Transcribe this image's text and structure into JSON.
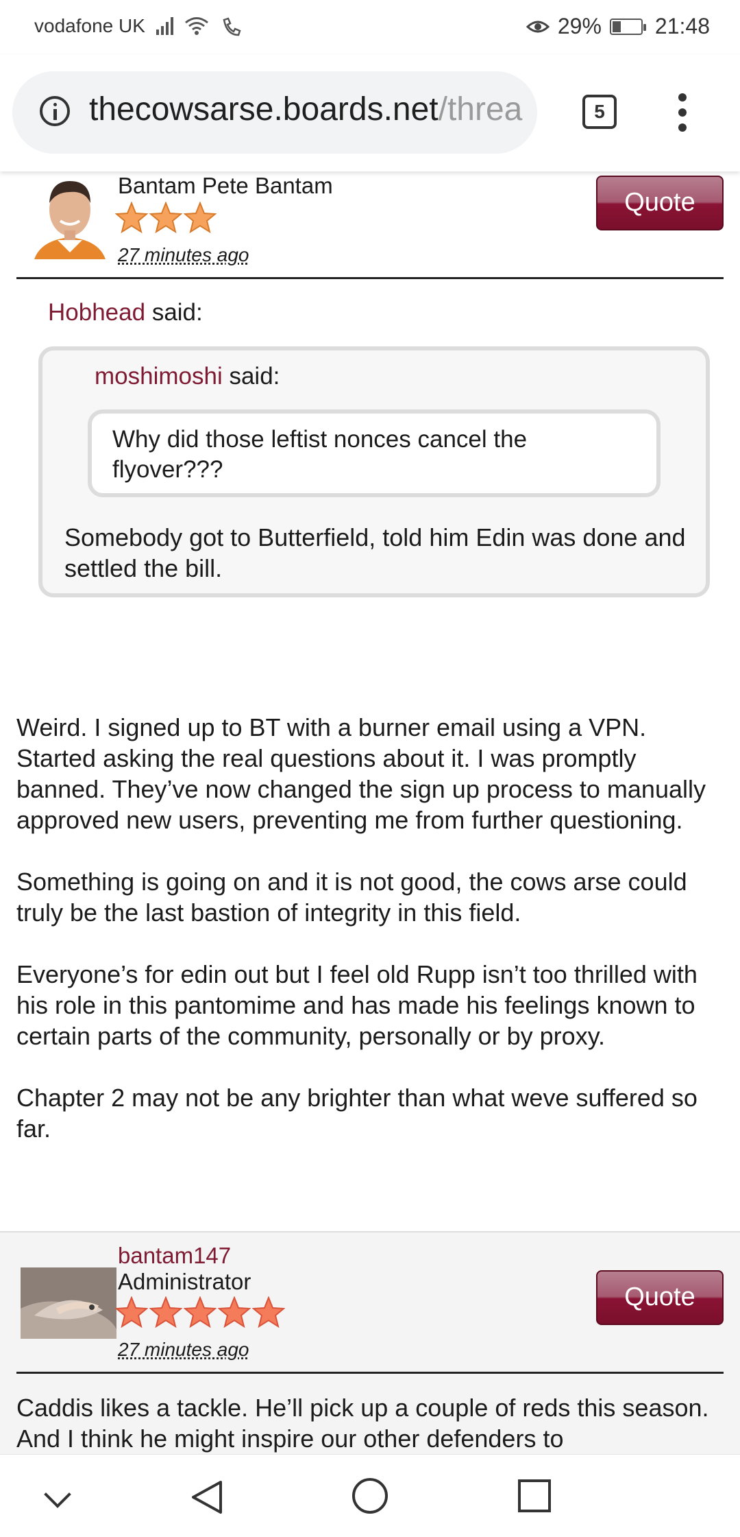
{
  "status_bar": {
    "carrier": "vodafone UK",
    "battery": "29%",
    "time": "21:48"
  },
  "browser": {
    "url_host": "thecowsarse.boards.net",
    "url_path": "/threa",
    "tab_count": "5"
  },
  "posts": [
    {
      "username": "Bantam Pete Bantam",
      "role": "",
      "stars": 3,
      "time": "27 minutes ago",
      "quote_label": "Quote",
      "quote": {
        "author": "Hobhead",
        "said": "said:",
        "nested": {
          "author": "moshimoshi",
          "said": "said:",
          "text": "Why did those leftist nonces cancel the flyover???"
        },
        "text": "Somebody got to Butterfield, told him Edin was done and settled the bill."
      },
      "paragraphs": [
        "Weird. I signed up to BT with a burner email using a VPN. Started asking the real questions about it. I was promptly banned. They’ve now changed the sign up process to manually approved new users, preventing me from further questioning.",
        "Something is going on and it is not good, the cows arse could truly be the last bastion of integrity in this field.",
        "Everyone’s for edin out but I feel old Rupp isn’t too thrilled with his role in this pantomime and has made his feelings known to certain parts of the community, personally or by proxy.",
        "Chapter 2 may not be any brighter than what weve suffered so far."
      ]
    },
    {
      "username": "bantam147",
      "role": "Administrator",
      "stars": 5,
      "time": "27 minutes ago",
      "quote_label": "Quote",
      "paragraphs": [
        "Caddis likes a tackle. He’ll pick up a couple of reds this season. And I think he might inspire our other defenders to"
      ]
    }
  ],
  "colors": {
    "link": "#7e1a32",
    "quote_button": "#8a1334",
    "star": "#f7a25c"
  }
}
